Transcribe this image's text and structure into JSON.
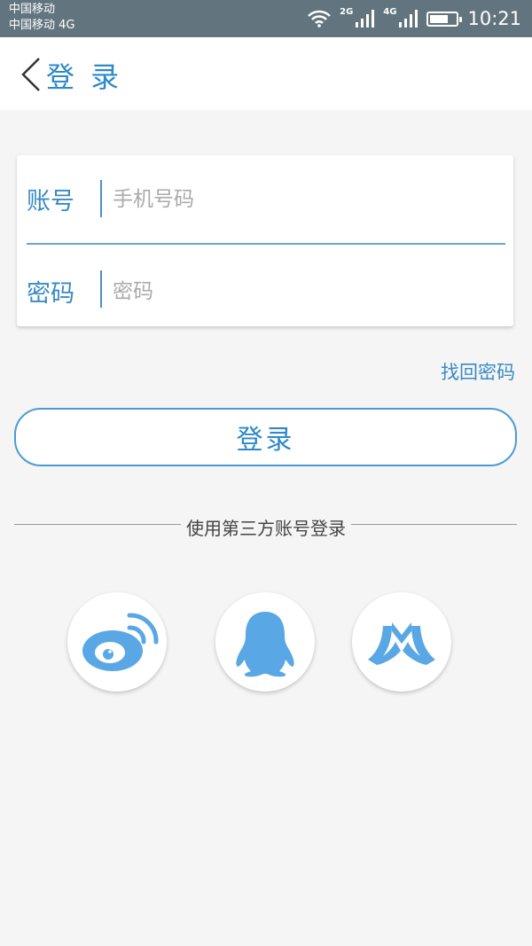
{
  "status_bar": {
    "carrier_1": "中国移动",
    "carrier_2": "中国移动 4G",
    "net_2g": "2G",
    "net_4g": "4G",
    "time": "10:21",
    "battery_level": 0.7,
    "icons": [
      "wifi-icon",
      "signal-icon",
      "signal-icon",
      "battery-icon"
    ]
  },
  "header": {
    "title": "登 录",
    "back_icon": "chevron-left-icon"
  },
  "form": {
    "account_label": "账号",
    "account_placeholder": "手机号码",
    "account_value": "",
    "password_label": "密码",
    "password_placeholder": "密码",
    "password_value": ""
  },
  "forgot_password": "找回密码",
  "login_button": "登录",
  "third_party": {
    "label": "使用第三方账号登录",
    "providers": [
      "weibo-icon",
      "qq-icon",
      "renren-icon"
    ]
  },
  "colors": {
    "accent": "#2d89c8",
    "status_bar": "#62757f",
    "icon_blue": "#5aa7e6",
    "background": "#f5f5f5"
  }
}
